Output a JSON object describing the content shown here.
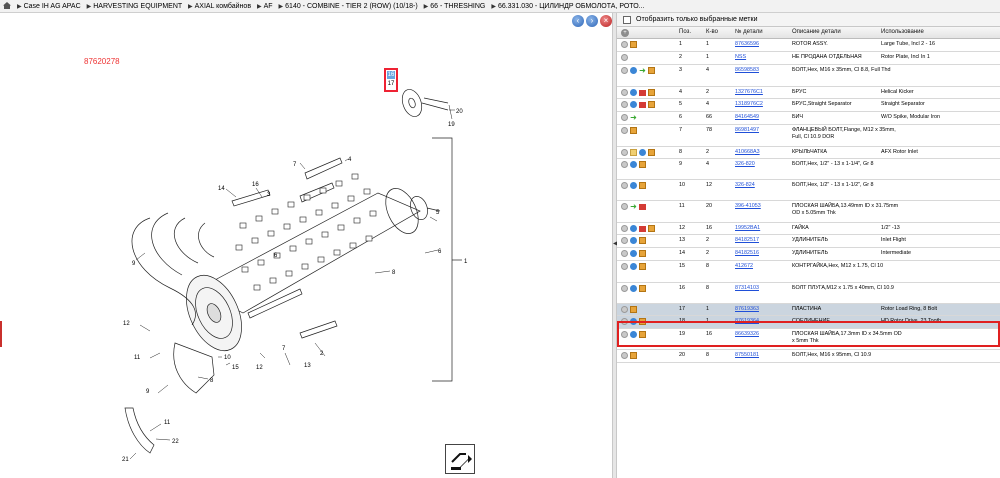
{
  "breadcrumb": [
    "Case IH AG APAC",
    "HARVESTING EQUIPMENT",
    "AXIAL комбайнов",
    "AF",
    "6140 - COMBINE - TIER 2 (ROW) (10/18-)",
    "66 - THRESHING",
    "66.331.030 - ЦИЛИНДР ОБМОЛОТА, РОТО..."
  ],
  "diagram": {
    "id_label": "87620278",
    "callout_selected": "16",
    "callout_next": "17",
    "assembly_label": "1"
  },
  "filter": {
    "label": "Отобразить только выбранные метки"
  },
  "table": {
    "headers": [
      "Поз.",
      "К-во",
      "№ детали",
      "Описание детали",
      "Использование"
    ],
    "rows": [
      {
        "pos": "1",
        "qty": "1",
        "part": "87636596",
        "desc": "ROTOR ASSY.",
        "use": "Large Tube, Incl 2 - 16",
        "icons": [
          "ring",
          "box"
        ]
      },
      {
        "pos": "2",
        "qty": "1",
        "part": "NSS",
        "desc": "НЕ ПРОДАНА ОТДЕЛЬНАЯ",
        "use": "Rotor Plate, Incl In 1",
        "icons": [
          "ring"
        ]
      },
      {
        "pos": "3",
        "qty": "4",
        "part": "86598583",
        "desc": "БОЛТ,Hex, M16 x 35mm, Cl 8.8, Full Thd",
        "use": "",
        "icons": [
          "ring",
          "arrow",
          "green",
          "box"
        ]
      },
      {
        "pos": "4",
        "qty": "2",
        "part": "1327676C1",
        "desc": "БРУС",
        "use": "Helical Kicker",
        "icons": [
          "ring",
          "arrow",
          "red",
          "box"
        ]
      },
      {
        "pos": "5",
        "qty": "4",
        "part": "1318976C2",
        "desc": "БРУС,Straight Separator",
        "use": "Straight Separator",
        "icons": [
          "ring",
          "arrow",
          "red",
          "box"
        ]
      },
      {
        "pos": "6",
        "qty": "66",
        "part": "84164549",
        "desc": "БИЧ",
        "use": "W/O Spike, Modular Iron",
        "icons": [
          "ring",
          "green"
        ]
      },
      {
        "pos": "7",
        "qty": "78",
        "part": "86981497",
        "desc": "ФЛАНЦЕВЫЙ БОЛТ,Flange, M12 x 35mm, Full, Cl 10.9 DOR",
        "use": "",
        "icons": [
          "ring",
          "box"
        ]
      },
      {
        "pos": "8",
        "qty": "2",
        "part": "410668A3",
        "desc": "КРЫЛЬЧАТКА",
        "use": "AFX Rotor Inlet",
        "icons": [
          "ring",
          "doc",
          "arrow",
          "box"
        ]
      },
      {
        "pos": "9",
        "qty": "4",
        "part": "326-820",
        "desc": "БОЛТ,Hex, 1/2\" - 13 x 1-1/4\", Gr 8",
        "use": "",
        "icons": [
          "ring",
          "arrow",
          "box"
        ]
      },
      {
        "pos": "10",
        "qty": "12",
        "part": "326-824",
        "desc": "БОЛТ,Hex, 1/2\" - 13 x 1-1/2\", Gr 8",
        "use": "",
        "icons": [
          "ring",
          "arrow",
          "box"
        ]
      },
      {
        "pos": "11",
        "qty": "20",
        "part": "396-41053",
        "desc": "ПЛОСКАЯ ШАЙБА,13.49mm ID x 31.75mm OD x 5.05mm Thk",
        "use": "",
        "icons": [
          "ring",
          "green",
          "red"
        ]
      },
      {
        "pos": "12",
        "qty": "16",
        "part": "19952BA1",
        "desc": "ГАЙКА",
        "use": "1/2\" -13",
        "icons": [
          "ring",
          "arrow",
          "red",
          "box"
        ]
      },
      {
        "pos": "13",
        "qty": "2",
        "part": "84182517",
        "desc": "УДЛИНИТЕЛЬ",
        "use": "Inlet Flight",
        "icons": [
          "ring",
          "arrow",
          "box"
        ]
      },
      {
        "pos": "14",
        "qty": "2",
        "part": "84182516",
        "desc": "УДЛИНИТЕЛЬ",
        "use": "Intermediate",
        "icons": [
          "ring",
          "arrow",
          "box"
        ]
      },
      {
        "pos": "15",
        "qty": "8",
        "part": "412672",
        "desc": "КОНТРГАЙКА,Hex, M12 x 1.75, Cl 10",
        "use": "",
        "icons": [
          "ring",
          "arrow",
          "box"
        ]
      },
      {
        "pos": "16",
        "qty": "8",
        "part": "87314103",
        "desc": "БОЛТ ПЛУГА,M12 x 1.75 x 40mm, Cl 10.9",
        "use": "",
        "icons": [
          "ring",
          "arrow",
          "box"
        ]
      },
      {
        "pos": "17",
        "qty": "1",
        "part": "87619363",
        "desc": "ПЛАСТИНА",
        "use": "Rotor Load Ring, 8 Bolt",
        "icons": [
          "ring",
          "box"
        ]
      },
      {
        "pos": "18",
        "qty": "1",
        "part": "87619364",
        "desc": "СОЕДИНЕНИЕ",
        "use": "HD Rotor Drive, 23 Tooth",
        "icons": [
          "ring",
          "arrow",
          "box"
        ]
      },
      {
        "pos": "19",
        "qty": "16",
        "part": "86639326",
        "desc": "ПЛОСКАЯ ШАЙБА,17.3mm ID x 34.5mm OD x 5mm Thk",
        "use": "",
        "icons": [
          "ring",
          "arrow",
          "box"
        ]
      },
      {
        "pos": "20",
        "qty": "8",
        "part": "87550181",
        "desc": "БОЛТ,Hex, M16 x 95mm, Cl 10.9",
        "use": "",
        "icons": [
          "ring",
          "box"
        ]
      }
    ]
  },
  "callouts": [
    "20",
    "19",
    "4",
    "7",
    "14",
    "16",
    "3",
    "5",
    "6",
    "8",
    "9",
    "1",
    "12",
    "11",
    "10",
    "15",
    "13",
    "2",
    "21",
    "22"
  ]
}
